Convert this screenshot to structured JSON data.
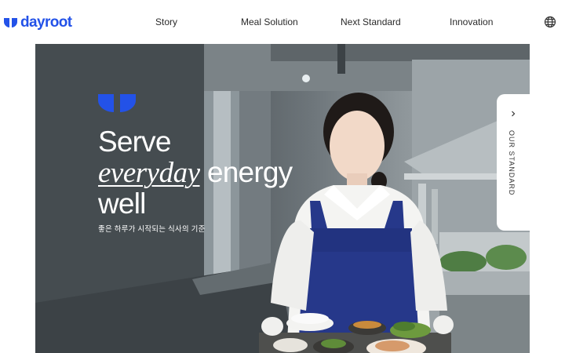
{
  "brand": {
    "name": "dayroot",
    "color": "#2352e8"
  },
  "nav": {
    "items": [
      {
        "label": "Story"
      },
      {
        "label": "Meal Solution"
      },
      {
        "label": "Next Standard"
      },
      {
        "label": "Innovation"
      }
    ],
    "language_icon": "globe-icon"
  },
  "hero": {
    "title_line1": "Serve",
    "title_accent": "everyday",
    "title_line2_rest": " energy",
    "title_line3": "well",
    "subtitle": "좋은 하루가 시작되는 식사의 기준",
    "image": "chef-with-tray-photo"
  },
  "side_tab": {
    "label": "OUR STANDARD",
    "icon": "chevron-right-icon"
  }
}
